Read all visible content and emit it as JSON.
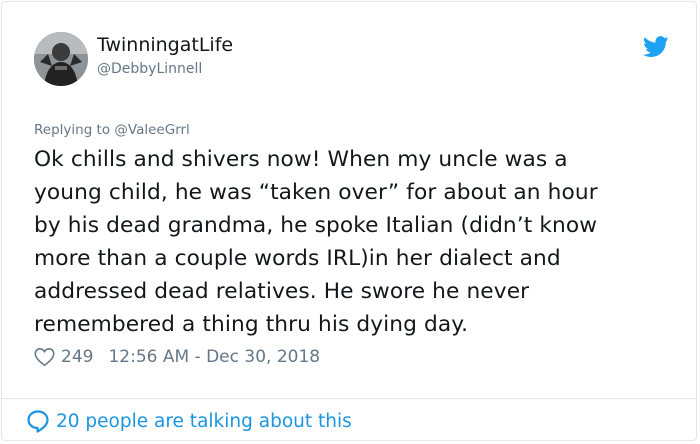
{
  "tweet": {
    "display_name": "TwinningatLife",
    "handle": "@DebbyLinnell",
    "reply_prefix": "Replying to",
    "reply_to": "@ValeeGrrl",
    "text_lines": [
      "Ok chills and shivers now! When my uncle was a",
      "young child, he was “taken over” for about an hour",
      "by his dead grandma, he spoke Italian (didn’t know",
      "more than a couple words IRL)in her dialect and",
      "addressed dead relatives. He swore he never",
      "remembered a thing thru his dying day."
    ],
    "likes": "249",
    "timestamp": "12:56 AM - Dec 30, 2018"
  },
  "footer": {
    "talking": "20 people are talking about this"
  },
  "icons": {
    "brand": "twitter-bird-icon",
    "like": "heart-icon",
    "conversation": "speech-bubble-icon"
  },
  "colors": {
    "twitter_blue": "#1da1f2",
    "link_blue": "#1b95e0",
    "secondary_text": "#657786",
    "border": "#e1e8ed"
  }
}
